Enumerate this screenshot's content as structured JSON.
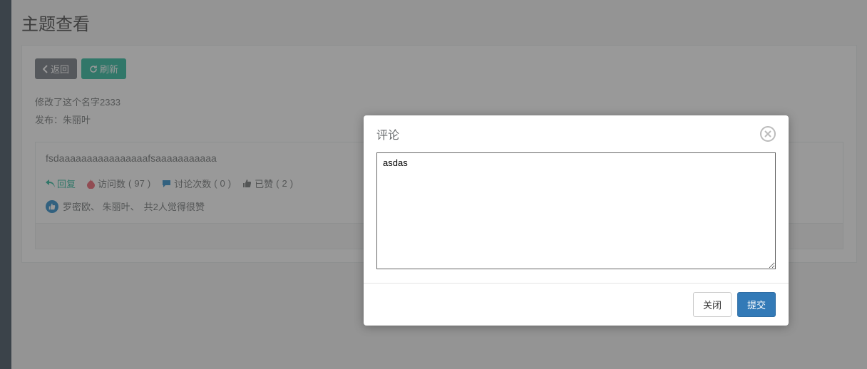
{
  "page": {
    "title": "主题查看"
  },
  "toolbar": {
    "back_label": "返回",
    "refresh_label": "刷新"
  },
  "topic": {
    "title": "修改了这个名字2333",
    "publisher_label": "发布：",
    "publisher": "朱丽叶",
    "content": "fsdaaaaaaaaaaaaaaaafsaaaaaaaaaaa"
  },
  "actions": {
    "reply_label": "回复",
    "visits_label": "访问数",
    "visits_count": 97,
    "discuss_label": "讨论次数",
    "discuss_count": 0,
    "liked_label": "已赞",
    "liked_count": 2
  },
  "likes": {
    "users": "罗密欧、 朱丽叶、",
    "suffix": "共2人觉得很赞"
  },
  "modal": {
    "title": "评论",
    "textarea_value": "asdas",
    "close_label": "关闭",
    "submit_label": "提交"
  }
}
